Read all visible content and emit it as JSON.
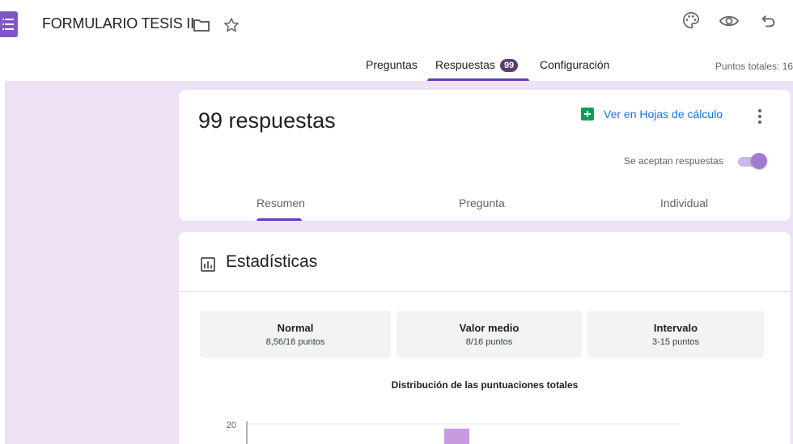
{
  "header": {
    "title": "FORMULARIO TESIS II",
    "icons": [
      "forms-logo",
      "folder-icon",
      "star-icon",
      "palette-icon",
      "eye-icon",
      "undo-icon"
    ]
  },
  "tabs": {
    "preguntas": "Preguntas",
    "respuestas": "Respuestas",
    "respuestas_badge": "99",
    "configuracion": "Configuración",
    "points_total": "Puntos totales: 16"
  },
  "responses_card": {
    "count_label": "99 respuestas",
    "sheets_link": "Ver en Hojas de cálculo",
    "accepting_label": "Se aceptan respuestas",
    "accepting_on": true,
    "subtabs": [
      "Resumen",
      "Pregunta",
      "Individual"
    ],
    "active_subtab": "Resumen"
  },
  "stats_card": {
    "title": "Estadísticas",
    "boxes": [
      {
        "label": "Normal",
        "value": "8,56/16 puntos"
      },
      {
        "label": "Valor medio",
        "value": "8/16 puntos"
      },
      {
        "label": "Intervalo",
        "value": "3-15 puntos"
      }
    ],
    "chart_title": "Distribución de las puntuaciones totales"
  },
  "chart_data": {
    "type": "bar",
    "title": "Distribución de las puntuaciones totales",
    "y_tick_labels": [
      "20"
    ],
    "visible_bar_partial": true
  },
  "colors": {
    "accent": "#673ab7",
    "background": "#ede1f5",
    "badge": "#5b3d6b",
    "sheets_green": "#0f9d58",
    "link_blue": "#1a73e8",
    "bar": "#c89ae0"
  }
}
